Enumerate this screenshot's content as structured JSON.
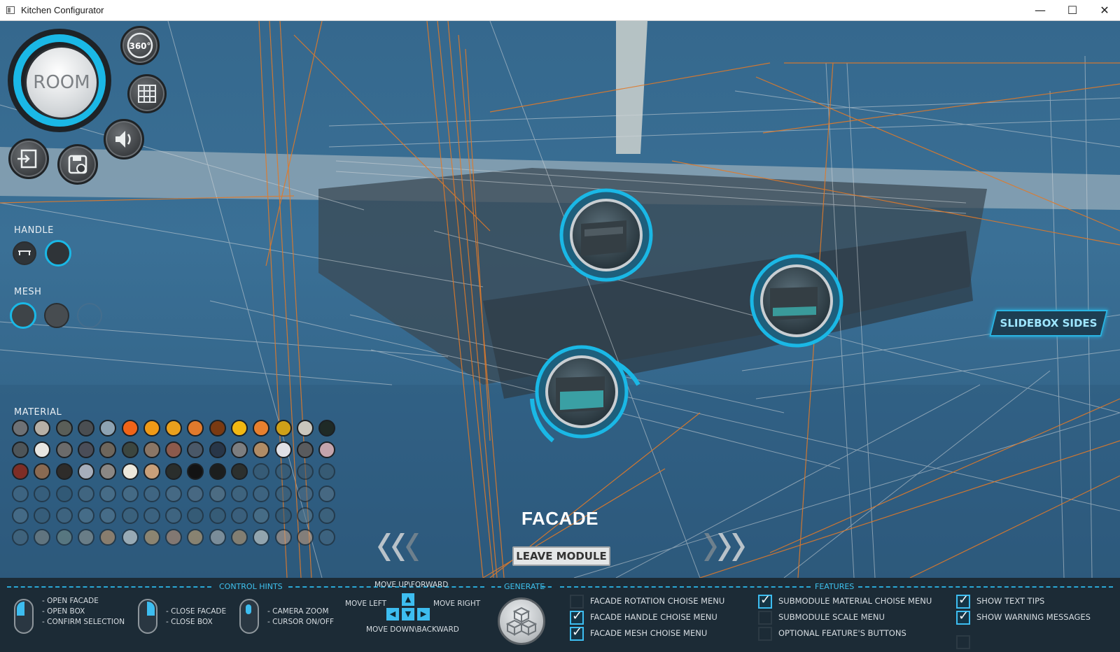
{
  "window": {
    "title": "Kitchen Configurator",
    "minimize_icon": "minimize-icon",
    "maximize_icon": "maximize-icon",
    "close_icon": "close-icon"
  },
  "hud": {
    "room_label": "ROOM",
    "view360_label": "360°",
    "buttons": [
      "view-360-icon",
      "grid-icon",
      "sound-icon",
      "exit-icon",
      "save-icon"
    ]
  },
  "side_panel": {
    "handle_title": "HANDLE",
    "mesh_title": "MESH",
    "material_title": "MATERIAL",
    "material_rows": [
      [
        "#6e7175",
        "#b7b0a6",
        "#5a5e58",
        "#4a4e52",
        "#8ea3b3",
        "#f06418",
        "#f09a16",
        "#eaa01c",
        "#e07a2c",
        "#7a3a12",
        "#f2b812",
        "#e8802e",
        "#cfa018",
        "#c9c6bd",
        "#1f2a26"
      ],
      [
        "#4e5559",
        "#e8e6e2",
        "#6b6b6b",
        "#4a4d58",
        "#6e665c",
        "#3c4640",
        "#8a7666",
        "#8c5a4c",
        "#4a5868",
        "#283648",
        "#7c7e80",
        "#b08c66",
        "#e0e0e6",
        "#595b5e",
        "#c4a4ac"
      ],
      [
        "#7e2e26",
        "#8a6a52",
        "#2e2c2a",
        "#a6aebb",
        "#8b8784",
        "#ece8dc",
        "#c8a07a",
        "#2a2e2c",
        "#131313",
        "#1c1e1e",
        "#2c302e",
        "#3d5a6e",
        "#3f5c70",
        "#40586a",
        "#3e5a6c"
      ],
      [
        "#4a6b82",
        "#3d6079",
        "#34576e",
        "#4f6d80",
        "#5a7a8e",
        "#56768a",
        "#4e6e84",
        "#587488",
        "#5c7384",
        "#667a86",
        "#4c6a7e",
        "#4a6a80",
        "#466478",
        "#546e82",
        "#5a7284"
      ],
      [
        "#56788c",
        "#3e6076",
        "#4a6a80",
        "#587a90",
        "#5a7a90",
        "#44667c",
        "#466880",
        "#4c6c82",
        "#3c5c70",
        "#3e5e72",
        "#44647a",
        "#5a7a8c",
        "#3a5a6e",
        "#5c7a8c",
        "#46667a"
      ],
      [
        "#4e6a7c",
        "#8a8a80",
        "#7a8e82",
        "#9a9a90",
        "#d49a62",
        "#f0ece2",
        "#d8a868",
        "#c8906a",
        "#d2a468",
        "#b8b6b0",
        "#c89c6a",
        "#e6e2d6",
        "#c8a48a",
        "#c89c78",
        "#4a6a80"
      ]
    ]
  },
  "viewport": {
    "slidebox_label": "SLIDEBOX SIDES",
    "module_title": "FACADE",
    "leave_button": "LEAVE MODULE",
    "prev_icon": "chevron-left-icon",
    "next_icon": "chevron-right-icon"
  },
  "bottom": {
    "control_hints_title": "CONTROL HINTS",
    "hint_left": "- OPEN FACADE\n- OPEN BOX\n- CONFIRM SELECTION",
    "hint_right": "- CLOSE FACADE\n- CLOSE BOX",
    "hint_middle": "- CAMERA ZOOM\n- CURSOR ON/OFF",
    "move_up": "MOVE UP\\FORWARD",
    "move_left": "MOVE LEFT",
    "move_right": "MOVE RIGHT",
    "move_down": "MOVE DOWN\\BACKWARD",
    "generate_title": "GENERATE",
    "features_title": "FEATURES",
    "features": [
      {
        "label": "FACADE ROTATION CHOISE MENU",
        "checked": false
      },
      {
        "label": "FACADE HANDLE CHOISE MENU",
        "checked": true
      },
      {
        "label": "FACADE MESH CHOISE MENU",
        "checked": true
      },
      {
        "label": "SUBMODULE MATERIAL CHOISE MENU",
        "checked": true
      },
      {
        "label": "SUBMODULE SCALE MENU",
        "checked": false
      },
      {
        "label": "OPTIONAL FEATURE'S BUTTONS",
        "checked": false
      },
      {
        "label": "SHOW TEXT TIPS",
        "checked": true
      },
      {
        "label": "SHOW WARNING MESSAGES",
        "checked": true
      }
    ]
  }
}
